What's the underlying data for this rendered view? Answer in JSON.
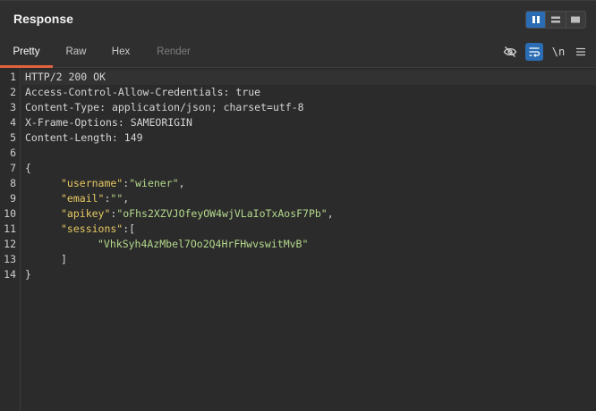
{
  "header": {
    "title": "Response"
  },
  "tabs": [
    {
      "label": "Pretty"
    },
    {
      "label": "Raw"
    },
    {
      "label": "Hex"
    },
    {
      "label": "Render"
    }
  ],
  "toolbar": {
    "icons": [
      "eye-off-icon",
      "word-wrap-icon",
      "newline-icon",
      "menu-icon"
    ],
    "newline_label": "\\n"
  },
  "view_toggle": [
    "split-vertical-icon",
    "split-horizontal-icon",
    "single-pane-icon"
  ],
  "colors": {
    "accent": "#2a6db5",
    "tab_underline": "#e0633f",
    "json_key": "#e6c862",
    "json_string": "#b4d98c"
  },
  "editor": {
    "line_numbers": [
      "1",
      "2",
      "3",
      "4",
      "5",
      "6",
      "7",
      "8",
      "9",
      "10",
      "11",
      "12",
      "13",
      "14"
    ],
    "headers": {
      "status": "HTTP/2 200 OK",
      "h1_name": "Access-Control-Allow-Credentials:",
      "h1_value": " true",
      "h2_name": "Content-Type:",
      "h2_value": " application/json; charset=utf-8",
      "h3_name": "X-Frame-Options:",
      "h3_value": " SAMEORIGIN",
      "h4_name": "Content-Length:",
      "h4_value": " 149"
    },
    "body": {
      "open_brace": "{",
      "username_key": "\"username\"",
      "username_value": "\"wiener\"",
      "email_key": "\"email\"",
      "email_value": "\"\"",
      "apikey_key": "\"apikey\"",
      "apikey_value": "\"oFhs2XZVJOfeyOW4wjVLaIoTxAosF7Pb\"",
      "sessions_key": "\"sessions\"",
      "session_value": "\"VhkSyh4AzMbel7Oo2Q4HrFHwvswitMvB\"",
      "close_bracket": "]",
      "close_brace": "}"
    }
  }
}
